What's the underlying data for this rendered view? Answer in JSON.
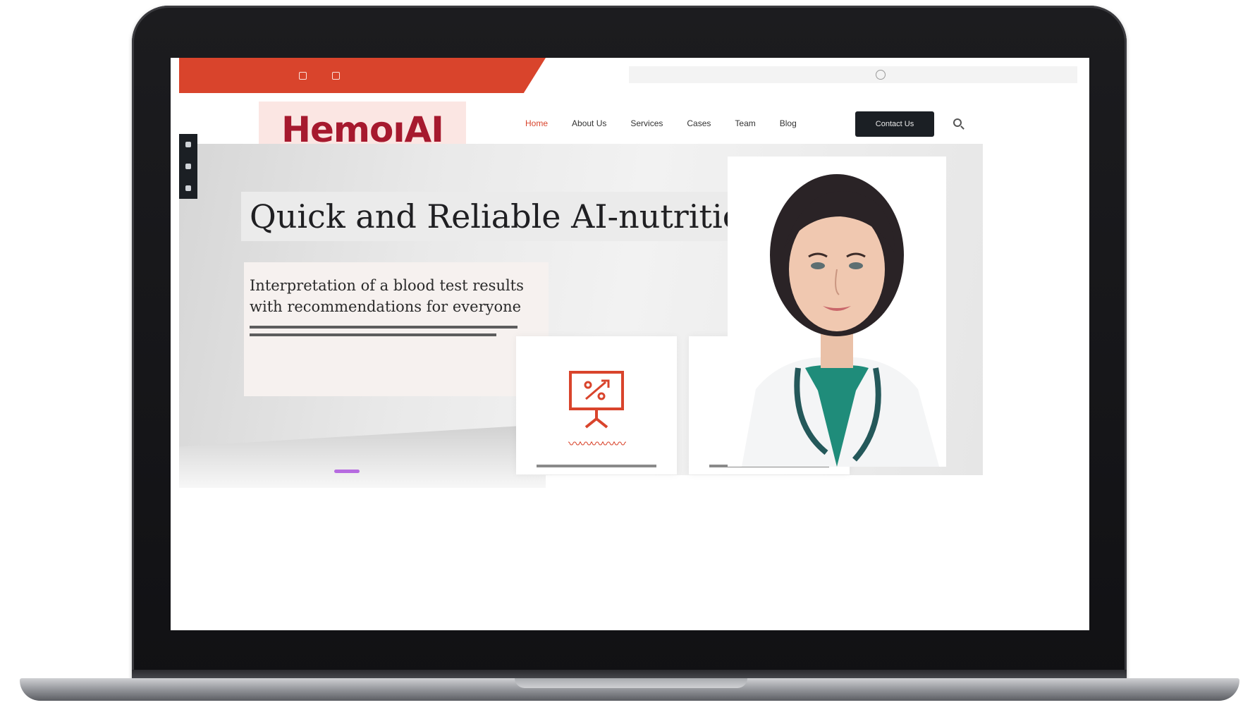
{
  "site": {
    "logo_text": "HemoıAI",
    "nav": [
      "Home",
      "About Us",
      "Services",
      "Cases",
      "Team",
      "Blog"
    ],
    "active_nav": 0,
    "contact_button": "Contact Us",
    "hero_title": "Quick and Reliable AI-nutritionist",
    "hero_subtitle": "Interpretation of a blood test results with recommendations for everyone"
  },
  "colors": {
    "accent": "#d9442c",
    "brand": "#a6192e",
    "dark": "#1b1f24",
    "slider_dot": "#b66be0"
  },
  "icons": [
    "phone-icon",
    "mail-icon",
    "globe-icon",
    "search-icon",
    "presentation-chart-icon",
    "scales-icon"
  ]
}
